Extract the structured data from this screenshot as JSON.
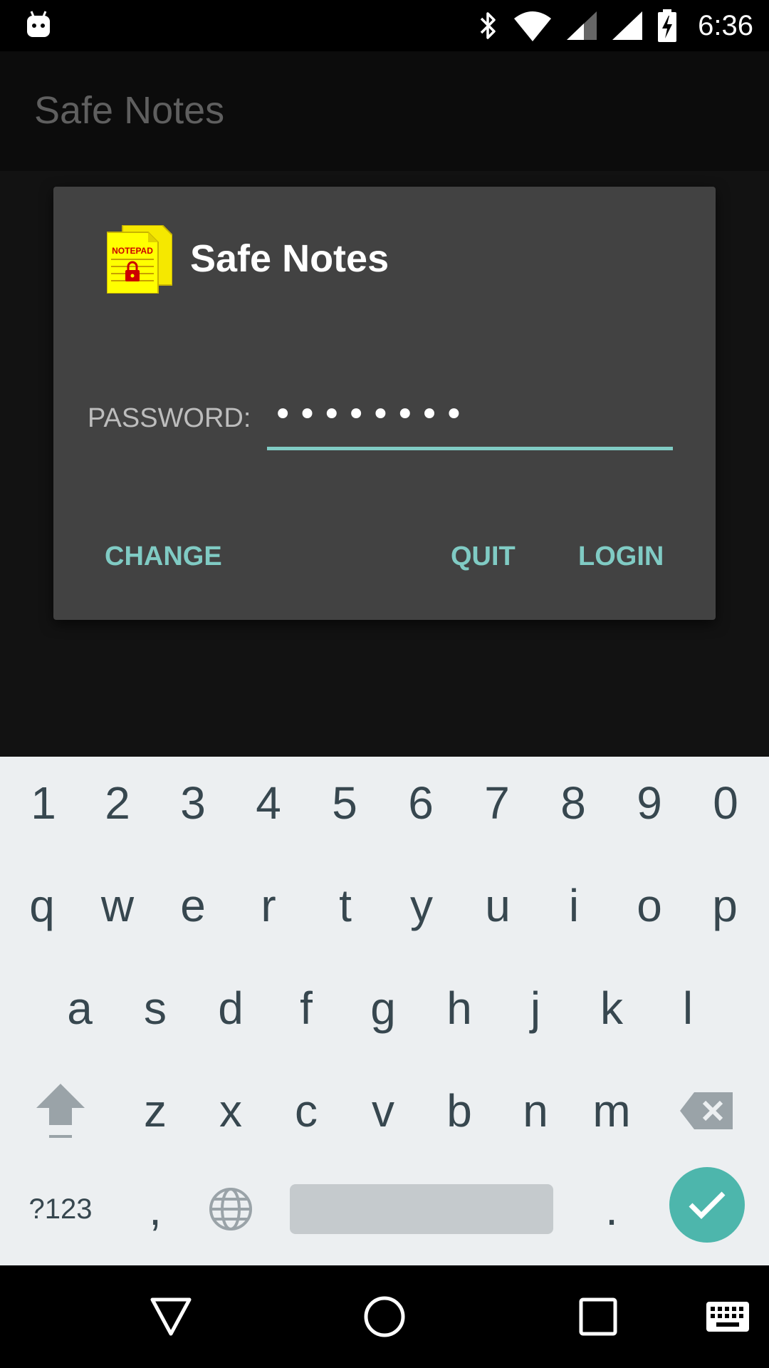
{
  "status_bar": {
    "time": "6:36",
    "icons": [
      "android-debug-icon",
      "bluetooth-icon",
      "wifi-icon",
      "cell-signal-icon",
      "cell-signal-full-icon",
      "battery-charging-icon"
    ]
  },
  "app_bar": {
    "title": "Safe Notes"
  },
  "dialog": {
    "title": "Safe Notes",
    "logo_text": "NOTEPAD",
    "password_label": "PASSWORD:",
    "password_value": "••••••••",
    "buttons": {
      "change": "CHANGE",
      "quit": "QUIT",
      "login": "LOGIN"
    },
    "accent_color": "#80cbc4"
  },
  "keyboard": {
    "row_numbers": [
      "1",
      "2",
      "3",
      "4",
      "5",
      "6",
      "7",
      "8",
      "9",
      "0"
    ],
    "row_1": [
      "q",
      "w",
      "e",
      "r",
      "t",
      "y",
      "u",
      "i",
      "o",
      "p"
    ],
    "row_2": [
      "a",
      "s",
      "d",
      "f",
      "g",
      "h",
      "j",
      "k",
      "l"
    ],
    "row_3": [
      "z",
      "x",
      "c",
      "v",
      "b",
      "n",
      "m"
    ],
    "symbols_key": "?123",
    "comma_key": ",",
    "period_key": ".",
    "done_color": "#4db6ac"
  },
  "nav_bar": {
    "icons": [
      "back-icon",
      "home-icon",
      "recents-icon",
      "keyboard-switch-icon"
    ]
  }
}
